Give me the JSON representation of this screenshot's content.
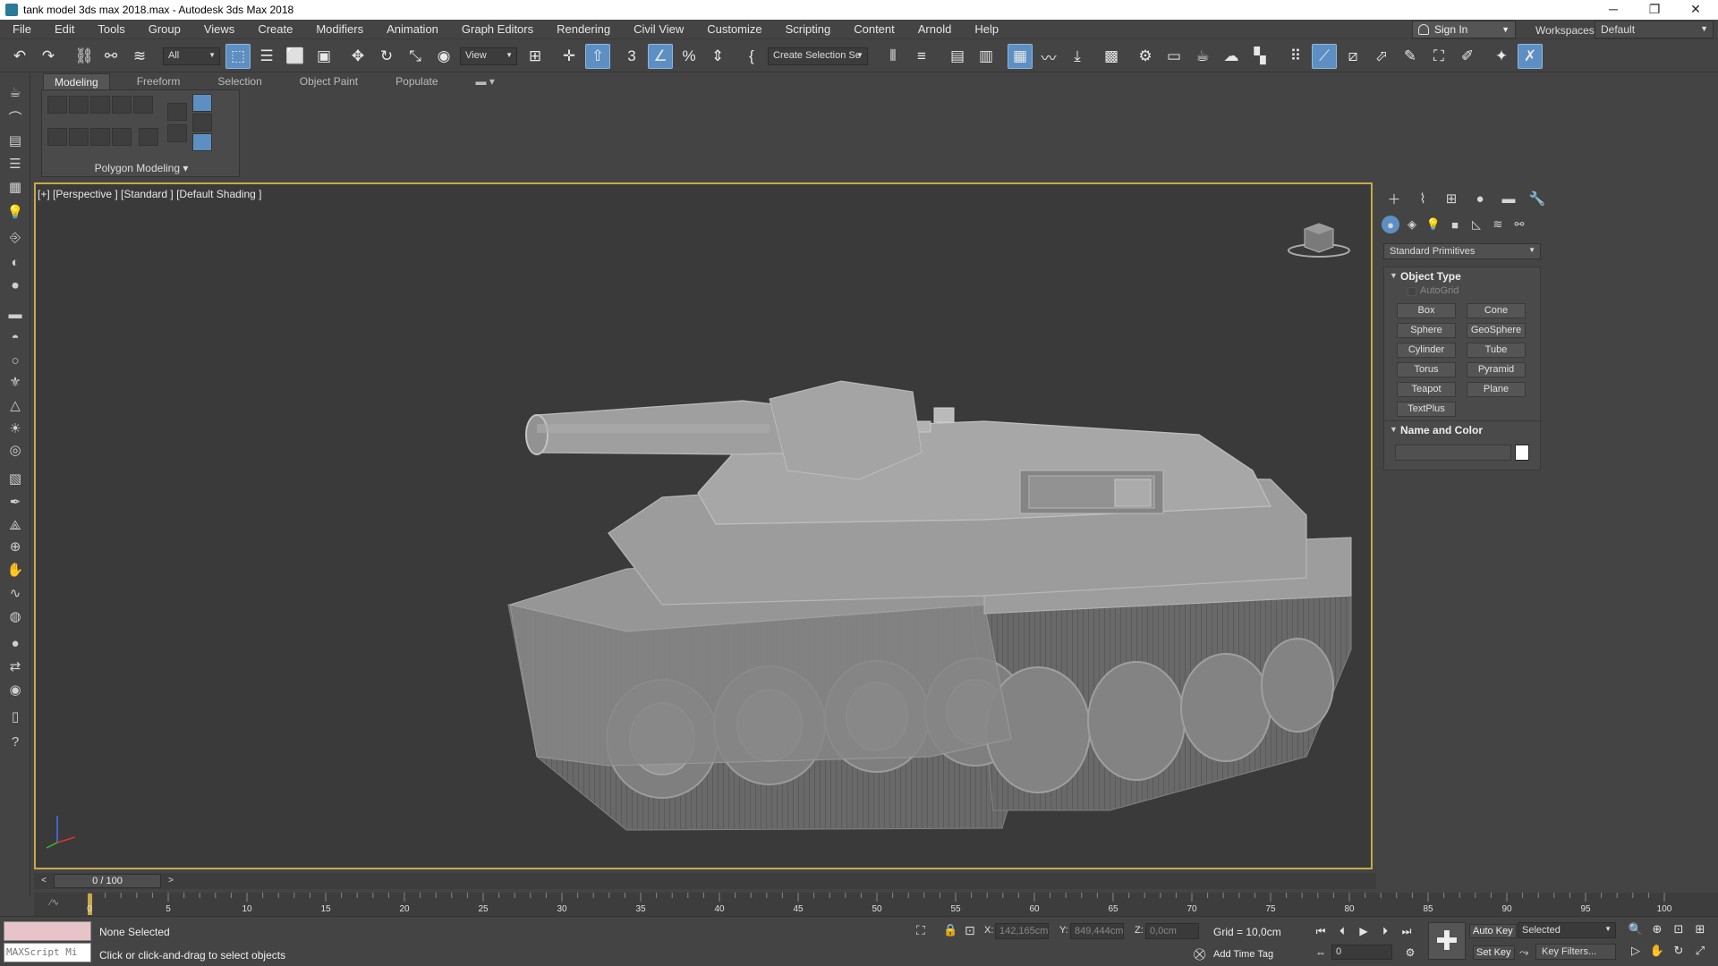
{
  "window": {
    "title": "tank model 3ds max 2018.max - Autodesk 3ds Max 2018",
    "minimize": "─",
    "restore": "❐",
    "close": "✕"
  },
  "menu": [
    "File",
    "Edit",
    "Tools",
    "Group",
    "Views",
    "Create",
    "Modifiers",
    "Animation",
    "Graph Editors",
    "Rendering",
    "Civil View",
    "Customize",
    "Scripting",
    "Content",
    "Arnold",
    "Help"
  ],
  "account": {
    "sign_in": "Sign In",
    "workspaces_label": "Workspaces:",
    "workspace": "Default"
  },
  "toolbar": {
    "selection_filter": "All",
    "ref_coord": "View",
    "named_selection": "Create Selection Se"
  },
  "ribbon": {
    "tabs": [
      "Modeling",
      "Freeform",
      "Selection",
      "Object Paint",
      "Populate"
    ],
    "active_tab": "Modeling",
    "panel_title": "Polygon Modeling ▾"
  },
  "viewport": {
    "label": "[+] [Perspective ] [Standard ] [Default Shading ]"
  },
  "command_panel": {
    "category": "Standard Primitives",
    "object_type_title": "Object Type",
    "autogrid": "AutoGrid",
    "primitives": [
      "Box",
      "Cone",
      "Sphere",
      "GeoSphere",
      "Cylinder",
      "Tube",
      "Torus",
      "Pyramid",
      "Teapot",
      "Plane",
      "TextPlus"
    ],
    "name_color_title": "Name and Color"
  },
  "timeline": {
    "frame_display": "0 / 100",
    "ticks": [
      "0",
      "5",
      "10",
      "15",
      "20",
      "25",
      "30",
      "35",
      "40",
      "45",
      "50",
      "55",
      "60",
      "65",
      "70",
      "75",
      "80",
      "85",
      "90",
      "95",
      "100"
    ]
  },
  "status": {
    "maxscript": "MAXScript Mi",
    "selection": "None Selected",
    "prompt": "Click or click-and-drag to select objects",
    "x_label": "X:",
    "x_value": "142,165cm",
    "y_label": "Y:",
    "y_value": "849,444cm",
    "z_label": "Z:",
    "z_value": "0,0cm",
    "grid": "Grid = 10,0cm",
    "add_time_tag": "Add Time Tag",
    "frame": "0",
    "auto_key": "Auto Key",
    "set_key": "Set Key",
    "key_mode": "Selected",
    "key_filters": "Key Filters..."
  }
}
